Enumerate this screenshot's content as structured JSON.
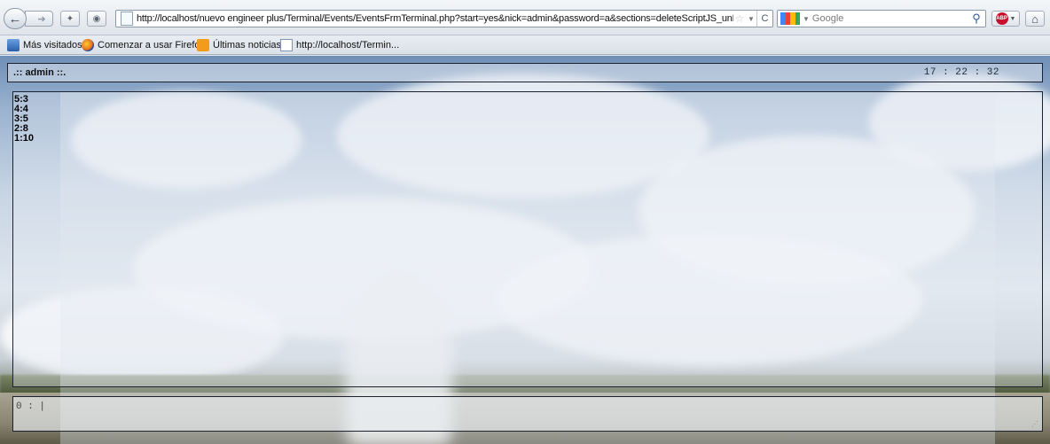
{
  "browser": {
    "url": "http://localhost/nuevo engineer plus/Terminal/Events/EventsFrmTerminal.php?start=yes&nick=admin&password=a&sections=deleteScriptJS_unRegiste",
    "search_placeholder": "Google",
    "icons": {
      "back": "back-arrow-icon",
      "forward": "forward-arrow-icon",
      "bookmark_star": "star-icon",
      "reload": "reload-icon",
      "search": "magnifier-icon",
      "adblock": "adblock-icon",
      "home": "home-icon"
    }
  },
  "bookmarks": [
    {
      "label": "Más visitados",
      "icon": "most-visited-icon"
    },
    {
      "label": "Comenzar a usar Firefox",
      "icon": "firefox-icon"
    },
    {
      "label": "Últimas noticias",
      "icon": "rss-icon"
    },
    {
      "label": "http://localhost/Termin...",
      "icon": "page-icon"
    }
  ],
  "terminal": {
    "user_label": ".:: admin ::.",
    "clock": "17 : 22 : 32",
    "output_lines": [
      "5:3",
      "4:4",
      "3:5",
      "2:8",
      "1:10"
    ],
    "prompt": "0 : |"
  },
  "colors": {
    "border": "#1c2230",
    "accent_blue": "#2c5aa0",
    "adblock_red": "#c8102e"
  }
}
